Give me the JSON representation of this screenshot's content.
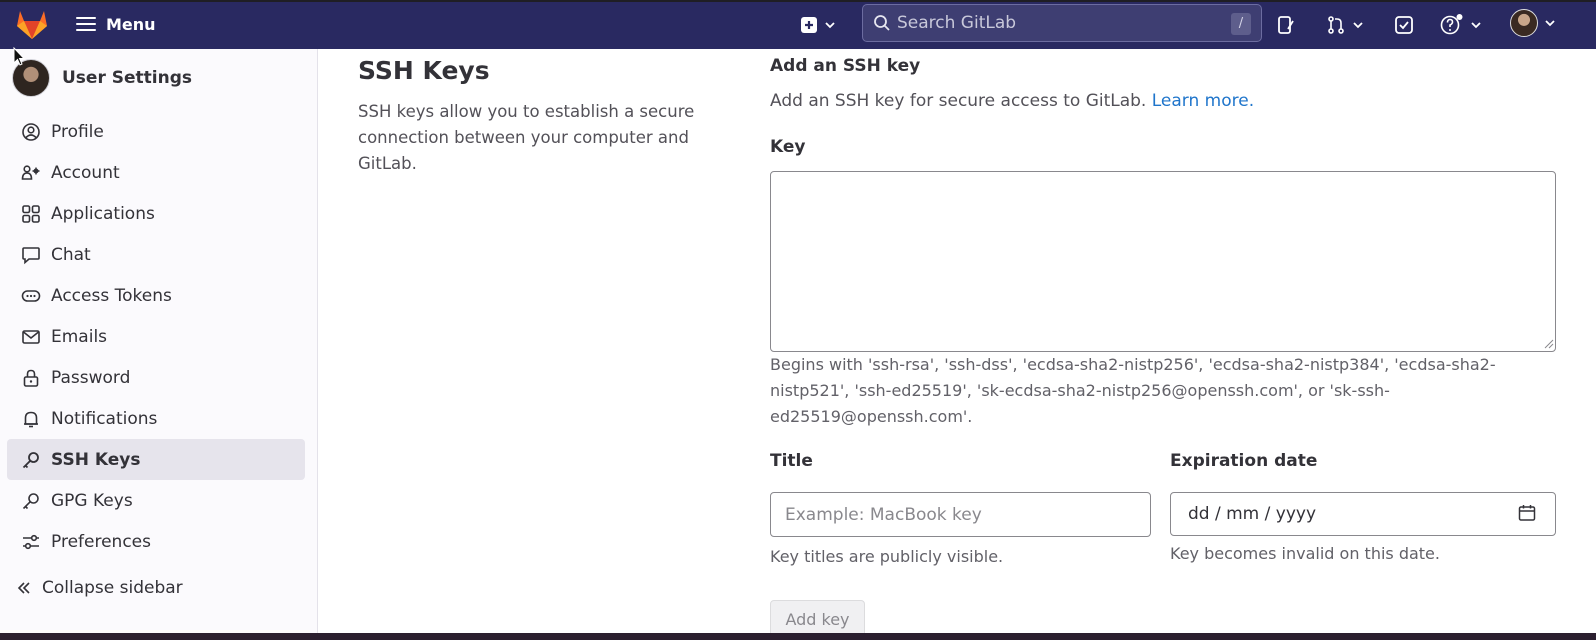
{
  "topbar": {
    "menu_label": "Menu",
    "search_placeholder": "Search GitLab",
    "search_shortcut": "/"
  },
  "sidebar": {
    "title": "User Settings",
    "items": [
      {
        "label": "Profile",
        "icon": "profile-icon"
      },
      {
        "label": "Account",
        "icon": "account-icon"
      },
      {
        "label": "Applications",
        "icon": "applications-icon"
      },
      {
        "label": "Chat",
        "icon": "chat-icon"
      },
      {
        "label": "Access Tokens",
        "icon": "token-icon"
      },
      {
        "label": "Emails",
        "icon": "mail-icon"
      },
      {
        "label": "Password",
        "icon": "lock-icon"
      },
      {
        "label": "Notifications",
        "icon": "bell-icon"
      },
      {
        "label": "SSH Keys",
        "icon": "key-icon",
        "active": true
      },
      {
        "label": "GPG Keys",
        "icon": "key-icon"
      },
      {
        "label": "Preferences",
        "icon": "preferences-icon"
      }
    ],
    "collapse_label": "Collapse sidebar"
  },
  "main": {
    "title": "SSH Keys",
    "description": "SSH keys allow you to establish a secure connection between your computer and GitLab.",
    "form": {
      "heading": "Add an SSH key",
      "intro": "Add an SSH key for secure access to GitLab.",
      "learn_more": "Learn more.",
      "key_label": "Key",
      "key_value": "",
      "key_help": "Begins with 'ssh-rsa', 'ssh-dss', 'ecdsa-sha2-nistp256', 'ecdsa-sha2-nistp384', 'ecdsa-sha2-nistp521', 'ssh-ed25519', 'sk-ecdsa-sha2-nistp256@openssh.com', or 'sk-ssh-ed25519@openssh.com'.",
      "title_label": "Title",
      "title_placeholder": "Example: MacBook key",
      "title_help": "Key titles are publicly visible.",
      "expiration_label": "Expiration date",
      "expiration_value": "dd / mm / yyyy",
      "expiration_help": "Key becomes invalid on this date.",
      "submit_label": "Add key"
    }
  },
  "colors": {
    "navbar": "#292961",
    "link": "#1f75cb",
    "sidebar_active": "#e6e4ec"
  }
}
